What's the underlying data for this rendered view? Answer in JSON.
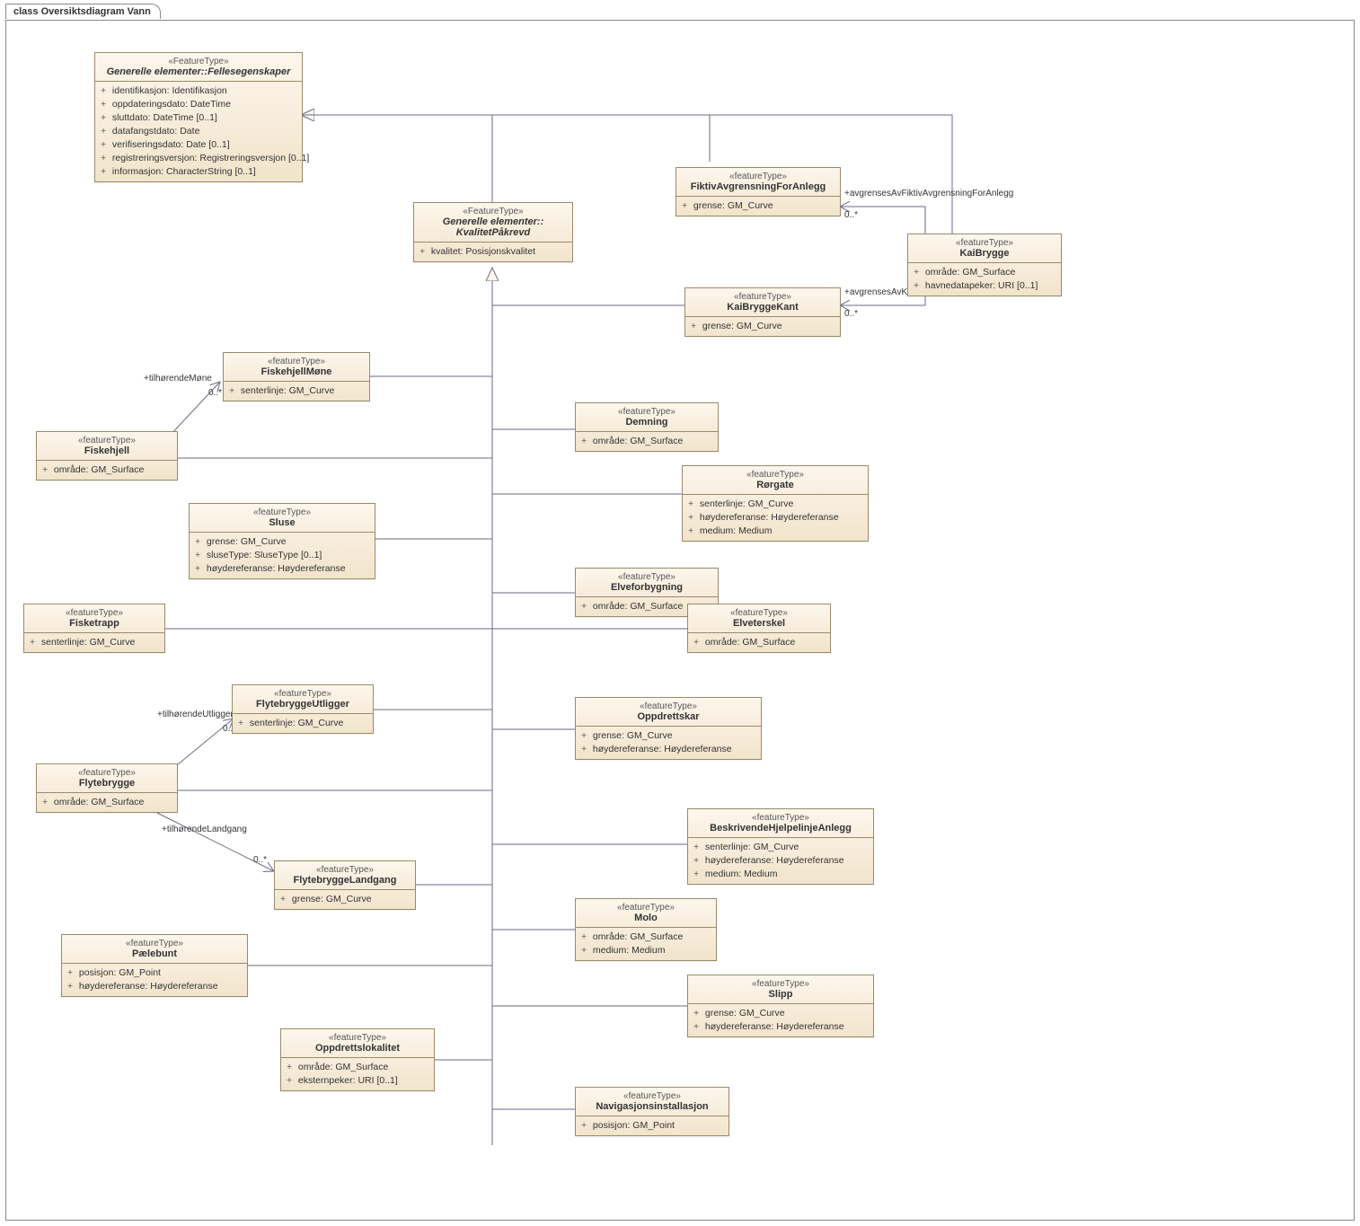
{
  "diagram": {
    "frame_label": "class Oversiktsdiagram Vann"
  },
  "stereotypes": {
    "FeatureType_big": "«FeatureType»",
    "featureType_small": "«featureType»"
  },
  "classes": {
    "Fellesegenskaper": {
      "stereotype": "«FeatureType»",
      "name": "Generelle elementer::Fellesegenskaper",
      "italic": true,
      "attrs": [
        {
          "v": "+",
          "t": "identifikasjon: Identifikasjon"
        },
        {
          "v": "+",
          "t": "oppdateringsdato: DateTime"
        },
        {
          "v": "+",
          "t": "sluttdato: DateTime [0..1]"
        },
        {
          "v": "+",
          "t": "datafangstdato: Date"
        },
        {
          "v": "+",
          "t": "verifiseringsdato: Date [0..1]"
        },
        {
          "v": "+",
          "t": "registreringsversjon: Registreringsversjon [0..1]"
        },
        {
          "v": "+",
          "t": "informasjon: CharacterString [0..1]"
        }
      ]
    },
    "KvalitetPakrevd": {
      "stereotype": "«FeatureType»",
      "name": "Generelle elementer::\nKvalitetPåkrevd",
      "italic": true,
      "attrs": [
        {
          "v": "+",
          "t": "kvalitet: Posisjonskvalitet"
        }
      ]
    },
    "FiktivAvgrensning": {
      "stereotype": "«featureType»",
      "name": "FiktivAvgrensningForAnlegg",
      "attrs": [
        {
          "v": "+",
          "t": "grense: GM_Curve"
        }
      ]
    },
    "KaiBrygge": {
      "stereotype": "«featureType»",
      "name": "KaiBrygge",
      "attrs": [
        {
          "v": "+",
          "t": "område: GM_Surface"
        },
        {
          "v": "+",
          "t": "havnedatapeker: URI [0..1]"
        }
      ]
    },
    "KaiBryggeKant": {
      "stereotype": "«featureType»",
      "name": "KaiBryggeKant",
      "attrs": [
        {
          "v": "+",
          "t": "grense: GM_Curve"
        }
      ]
    },
    "FiskehjellMone": {
      "stereotype": "«featureType»",
      "name": "FiskehjellMøne",
      "attrs": [
        {
          "v": "+",
          "t": "senterlinje: GM_Curve"
        }
      ]
    },
    "Fiskehjell": {
      "stereotype": "«featureType»",
      "name": "Fiskehjell",
      "attrs": [
        {
          "v": "+",
          "t": "område: GM_Surface"
        }
      ]
    },
    "Demning": {
      "stereotype": "«featureType»",
      "name": "Demning",
      "attrs": [
        {
          "v": "+",
          "t": "område: GM_Surface"
        }
      ]
    },
    "Rorgate": {
      "stereotype": "«featureType»",
      "name": "Rørgate",
      "attrs": [
        {
          "v": "+",
          "t": "senterlinje: GM_Curve"
        },
        {
          "v": "+",
          "t": "høydereferanse: Høydereferanse"
        },
        {
          "v": "+",
          "t": "medium: Medium"
        }
      ]
    },
    "Sluse": {
      "stereotype": "«featureType»",
      "name": "Sluse",
      "attrs": [
        {
          "v": "+",
          "t": "grense: GM_Curve"
        },
        {
          "v": "+",
          "t": "sluseType: SluseType [0..1]"
        },
        {
          "v": "+",
          "t": "høydereferanse: Høydereferanse"
        }
      ]
    },
    "Elveforbygning": {
      "stereotype": "«featureType»",
      "name": "Elveforbygning",
      "attrs": [
        {
          "v": "+",
          "t": "område: GM_Surface"
        }
      ]
    },
    "Fisketrapp": {
      "stereotype": "«featureType»",
      "name": "Fisketrapp",
      "attrs": [
        {
          "v": "+",
          "t": "senterlinje: GM_Curve"
        }
      ]
    },
    "Elveterskel": {
      "stereotype": "«featureType»",
      "name": "Elveterskel",
      "attrs": [
        {
          "v": "+",
          "t": "område: GM_Surface"
        }
      ]
    },
    "FlytebryggeUtligger": {
      "stereotype": "«featureType»",
      "name": "FlytebryggeUtligger",
      "attrs": [
        {
          "v": "+",
          "t": "senterlinje: GM_Curve"
        }
      ]
    },
    "Oppdrettskar": {
      "stereotype": "«featureType»",
      "name": "Oppdrettskar",
      "attrs": [
        {
          "v": "+",
          "t": "grense: GM_Curve"
        },
        {
          "v": "+",
          "t": "høydereferanse: Høydereferanse"
        }
      ]
    },
    "Flytebrygge": {
      "stereotype": "«featureType»",
      "name": "Flytebrygge",
      "attrs": [
        {
          "v": "+",
          "t": "område: GM_Surface"
        }
      ]
    },
    "BeskrivendeHjelpelinje": {
      "stereotype": "«featureType»",
      "name": "BeskrivendeHjelpelinjeAnlegg",
      "attrs": [
        {
          "v": "+",
          "t": "senterlinje: GM_Curve"
        },
        {
          "v": "+",
          "t": "høydereferanse: Høydereferanse"
        },
        {
          "v": "+",
          "t": "medium: Medium"
        }
      ]
    },
    "FlytebryggeLandgang": {
      "stereotype": "«featureType»",
      "name": "FlytebryggeLandgang",
      "attrs": [
        {
          "v": "+",
          "t": "grense: GM_Curve"
        }
      ]
    },
    "Molo": {
      "stereotype": "«featureType»",
      "name": "Molo",
      "attrs": [
        {
          "v": "+",
          "t": "område: GM_Surface"
        },
        {
          "v": "+",
          "t": "medium: Medium"
        }
      ]
    },
    "Paelebunt": {
      "stereotype": "«featureType»",
      "name": "Pælebunt",
      "attrs": [
        {
          "v": "+",
          "t": "posisjon: GM_Point"
        },
        {
          "v": "+",
          "t": "høydereferanse: Høydereferanse"
        }
      ]
    },
    "Slipp": {
      "stereotype": "«featureType»",
      "name": "Slipp",
      "attrs": [
        {
          "v": "+",
          "t": "grense: GM_Curve"
        },
        {
          "v": "+",
          "t": "høydereferanse: Høydereferanse"
        }
      ]
    },
    "Oppdrettslokalitet": {
      "stereotype": "«featureType»",
      "name": "Oppdrettslokalitet",
      "attrs": [
        {
          "v": "+",
          "t": "område: GM_Surface"
        },
        {
          "v": "+",
          "t": "eksternpeker: URI [0..1]"
        }
      ]
    },
    "Navigasjonsinstallasjon": {
      "stereotype": "«featureType»",
      "name": "Navigasjonsinstallasjon",
      "attrs": [
        {
          "v": "+",
          "t": "posisjon: GM_Point"
        }
      ]
    }
  },
  "assocLabels": {
    "tilhorendeMone": "+tilhørendeMøne",
    "tilhorendeUtligger": "+tilhørendeUtligger",
    "tilhorendeLandgang": "+tilhørendeLandgang",
    "avgrensesFiktiv": "+avgrensesAvFiktivAvgrensningForAnlegg",
    "avgrensesKaiKant": "+avgrensesAvKaiBryggeKant",
    "mult": "0..*"
  }
}
